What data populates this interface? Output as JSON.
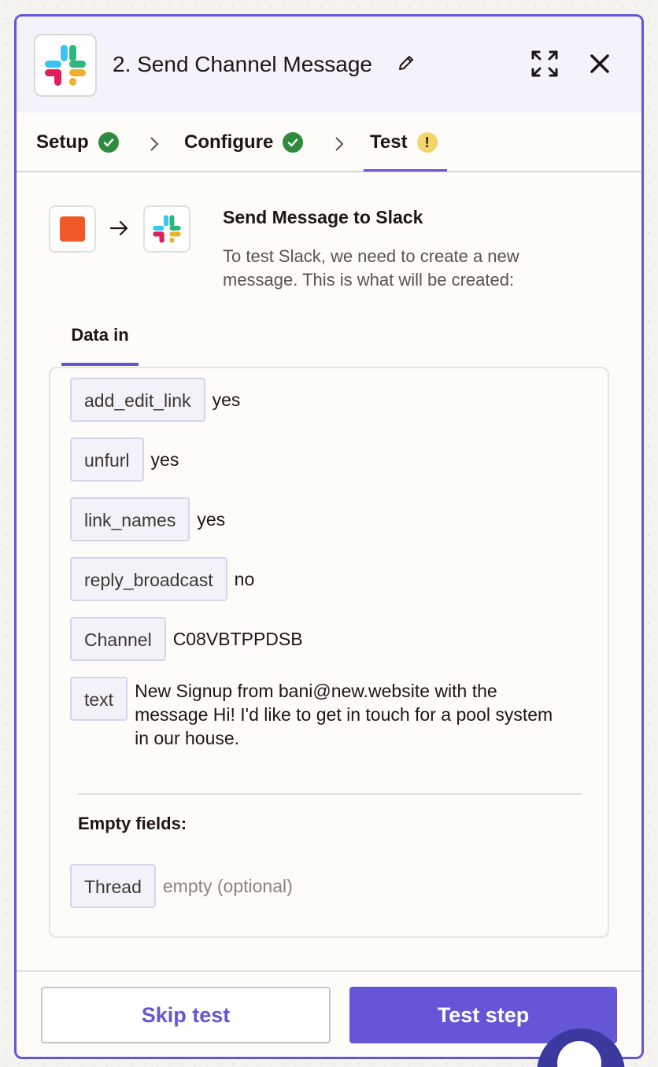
{
  "header": {
    "app_icon": "slack-logo",
    "title": "2. Send Channel Message",
    "icons": [
      "pencil-icon",
      "expand-icon",
      "close-icon"
    ]
  },
  "tabs": [
    {
      "label": "Setup",
      "status": "complete"
    },
    {
      "label": "Configure",
      "status": "complete"
    },
    {
      "label": "Test",
      "status": "warning",
      "badge": "!"
    }
  ],
  "flow": {
    "title": "Send Message to Slack",
    "description": "To test Slack, we need to create a new message. This is what will be created:",
    "source_color": "#f0592a"
  },
  "data_tab": "Data in",
  "fields": [
    {
      "key": "add_edit_link",
      "value": "yes"
    },
    {
      "key": "unfurl",
      "value": "yes"
    },
    {
      "key": "link_names",
      "value": "yes"
    },
    {
      "key": "reply_broadcast",
      "value": "no"
    },
    {
      "key": "Channel",
      "value": "C08VBTPPDSB"
    },
    {
      "key": "text",
      "value": "New Signup from bani@new.website with the message Hi! I'd like to get in touch for a pool system in our house."
    }
  ],
  "empty_section": {
    "title": "Empty fields:",
    "fields": [
      {
        "key": "Thread",
        "value": "empty (optional)"
      }
    ]
  },
  "footer": {
    "skip_label": "Skip test",
    "test_label": "Test step"
  },
  "colors": {
    "accent": "#6556d8",
    "success": "#2f8a3d",
    "warning": "#f2d56b"
  }
}
